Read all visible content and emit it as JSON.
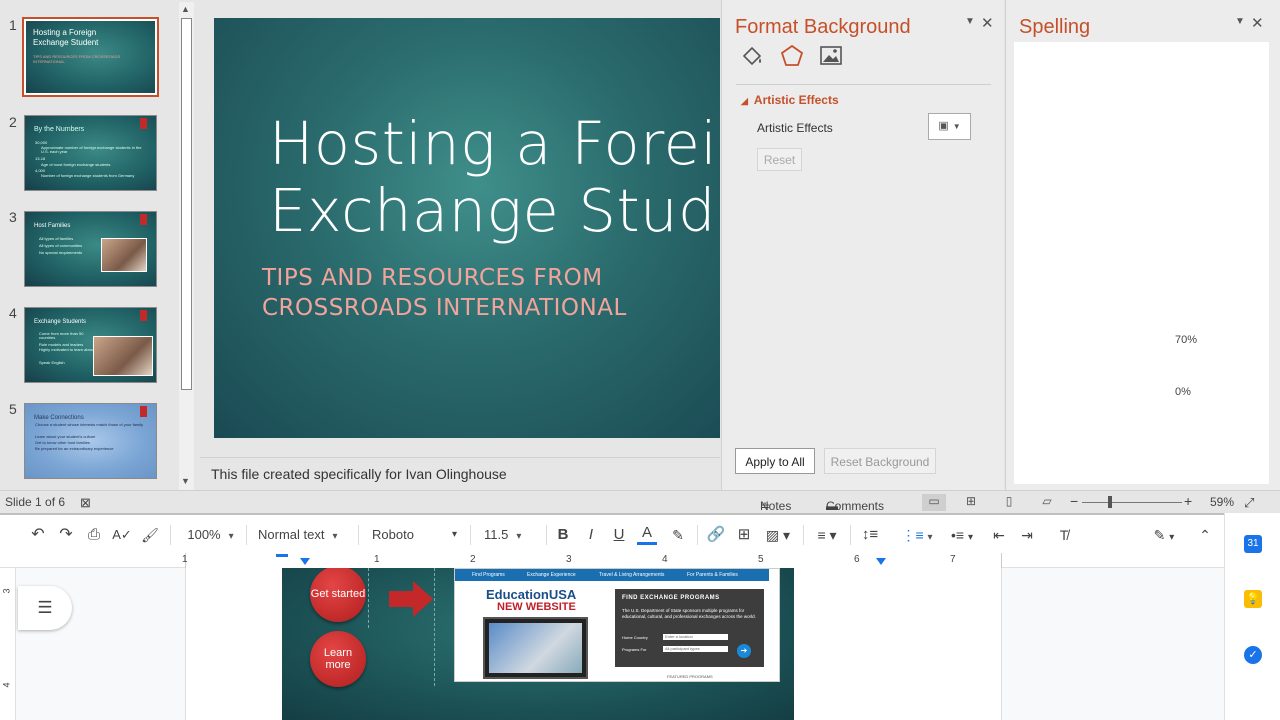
{
  "ppt": {
    "thumbnails": [
      {
        "num": "1",
        "title": "Hosting a Foreign Exchange Student",
        "sub": "TIPS AND RESOURCES FROM CROSSROADS INTERNATIONAL"
      },
      {
        "num": "2",
        "title": "By the Numbers",
        "bullets": [
          "30,000",
          "Approximate number of foreign exchange students in the U.S. each year",
          "13-18",
          "Age of most foreign exchange students",
          "4,000",
          "Number of foreign exchange students from Germany"
        ]
      },
      {
        "num": "3",
        "title": "Host Families",
        "bullets": [
          "All types of families",
          "All types of communities",
          "No special requirements"
        ]
      },
      {
        "num": "4",
        "title": "Exchange Students",
        "bullets": [
          "Come from more than 50 countries",
          "Role models and leaders",
          "Highly motivated to learn abroad",
          "Speak English"
        ]
      },
      {
        "num": "5",
        "title": "Make Connections",
        "bullets": [
          "Choose a student whose interests match those of your family",
          "Learn about your student's culture",
          "Get to know other host families",
          "Be prepared for an extraordinary experience"
        ]
      }
    ],
    "slide": {
      "title_line1": "Hosting a Foreign",
      "title_line2": "Exchange Student",
      "subtitle_line1": "TIPS AND RESOURCES FROM",
      "subtitle_line2": "CROSSROADS INTERNATIONAL"
    },
    "notes": "This file created specifically for Ivan Olinghouse",
    "format_background": {
      "title": "Format Background",
      "section": "Artistic Effects",
      "label": "Artistic Effects",
      "reset": "Reset",
      "apply_all": "Apply to All",
      "reset_background": "Reset Background",
      "icons": [
        "fill-icon",
        "effects-icon",
        "picture-icon"
      ]
    },
    "spelling": {
      "title": "Spelling",
      "pct1": "70%",
      "pct2": "0%"
    },
    "status": {
      "slide_info": "Slide 1 of 6",
      "notes": "Notes",
      "comments": "Comments",
      "zoom": "59%"
    },
    "colors": {
      "accent": "#c5502a",
      "slide_bg": "#2a6a6c",
      "subtitle": "#f2a39c"
    }
  },
  "gdocs": {
    "toolbar": {
      "zoom": "100%",
      "style": "Normal text",
      "font": "Roboto",
      "size": "11.5",
      "bold": "B",
      "italic": "I",
      "underline": "U",
      "text_color": "A"
    },
    "ruler": [
      "1",
      "1",
      "2",
      "3",
      "4",
      "5",
      "6",
      "7"
    ],
    "vruler": [
      "3",
      "4"
    ],
    "doc_image": {
      "btn1": "Get started",
      "btn2": "Learn more",
      "nav": [
        "Find Programs",
        "Exchange Experience",
        "Travel & Living Arrangements",
        "For Parents & Families"
      ],
      "brand1": "EducationUSA",
      "brand2": "NEW WEBSITE",
      "find_title": "FIND EXCHANGE PROGRAMS",
      "find_text": "The U.S. Department of State sponsors multiple programs for educational, cultural, and professional exchanges across the world.",
      "home_country_label": "Home Country",
      "home_country_value": "Enter a location",
      "programs_label": "Programs For",
      "programs_value": "All participant types",
      "featured": "FEATURED PROGRAMS"
    },
    "side_icons": [
      "calendar-icon",
      "keep-icon",
      "tasks-icon"
    ],
    "calendar_num": "31"
  }
}
